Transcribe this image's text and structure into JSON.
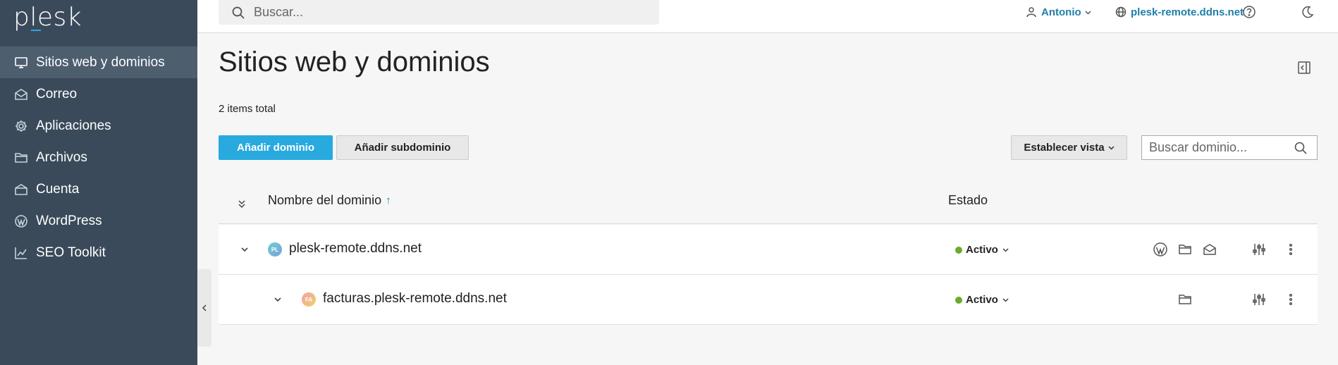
{
  "logo": {
    "text": "plesk"
  },
  "sidebar": {
    "items": [
      {
        "label": "Sitios web y dominios",
        "icon": "monitor-icon",
        "active": true
      },
      {
        "label": "Correo",
        "icon": "mail-icon"
      },
      {
        "label": "Aplicaciones",
        "icon": "gear-icon"
      },
      {
        "label": "Archivos",
        "icon": "folder-icon"
      },
      {
        "label": "Cuenta",
        "icon": "account-icon"
      },
      {
        "label": "WordPress",
        "icon": "wordpress-icon"
      },
      {
        "label": "SEO Toolkit",
        "icon": "chart-icon"
      }
    ]
  },
  "header": {
    "search_placeholder": "Buscar...",
    "user": "Antonio",
    "domain": "plesk-remote.ddns.net"
  },
  "page": {
    "title": "Sitios web y dominios",
    "items_total": "2 items total"
  },
  "toolbar": {
    "add_domain": "Añadir dominio",
    "add_subdomain": "Añadir subdominio",
    "set_view": "Establecer vista",
    "search_domain_placeholder": "Buscar dominio..."
  },
  "table": {
    "columns": {
      "name": "Nombre del dominio",
      "sort_arrow": "↑",
      "status": "Estado"
    },
    "rows": [
      {
        "favicon": "PL",
        "name": "plesk-remote.ddns.net",
        "status": "Activo"
      },
      {
        "favicon": "FA",
        "name": "facturas.plesk-remote.ddns.net",
        "status": "Activo"
      }
    ]
  },
  "colors": {
    "sidebar_bg": "#3a4a5a",
    "accent": "#28aade",
    "link": "#1f7ea9",
    "status_active": "#6aaa2e"
  }
}
